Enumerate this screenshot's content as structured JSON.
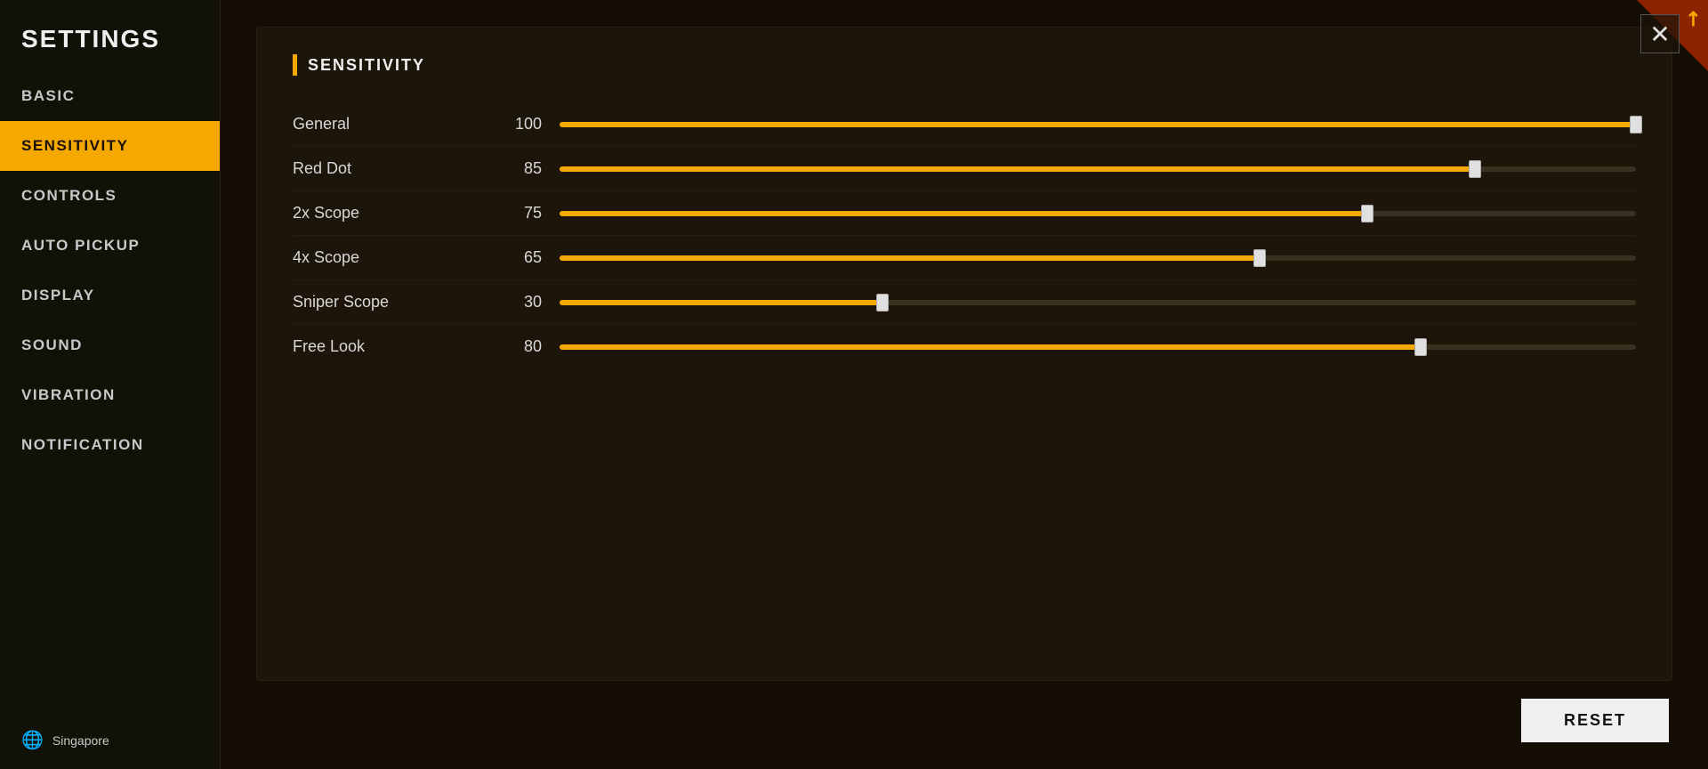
{
  "sidebar": {
    "title": "SETTINGS",
    "nav_items": [
      {
        "id": "basic",
        "label": "BASIC",
        "active": false
      },
      {
        "id": "sensitivity",
        "label": "SENSITIVITY",
        "active": true
      },
      {
        "id": "controls",
        "label": "CONTROLS",
        "active": false
      },
      {
        "id": "auto_pickup",
        "label": "AUTO PICKUP",
        "active": false
      },
      {
        "id": "display",
        "label": "DISPLAY",
        "active": false
      },
      {
        "id": "sound",
        "label": "SOUND",
        "active": false
      },
      {
        "id": "vibration",
        "label": "VIBRATION",
        "active": false
      },
      {
        "id": "notification",
        "label": "NOTIFICATION",
        "active": false
      }
    ],
    "footer_region": "Singapore"
  },
  "main": {
    "section_title": "SENSITIVITY",
    "sliders": [
      {
        "id": "general",
        "label": "General",
        "value": 100,
        "percent": 100
      },
      {
        "id": "red_dot",
        "label": "Red Dot",
        "value": 85,
        "percent": 85
      },
      {
        "id": "scope_2x",
        "label": "2x Scope",
        "value": 75,
        "percent": 75
      },
      {
        "id": "scope_4x",
        "label": "4x Scope",
        "value": 65,
        "percent": 65
      },
      {
        "id": "sniper_scope",
        "label": "Sniper Scope",
        "value": 30,
        "percent": 30
      },
      {
        "id": "free_look",
        "label": "Free Look",
        "value": 80,
        "percent": 80
      }
    ],
    "reset_button_label": "RESET"
  },
  "close_button_label": "✕",
  "corner_arrow": "↗"
}
